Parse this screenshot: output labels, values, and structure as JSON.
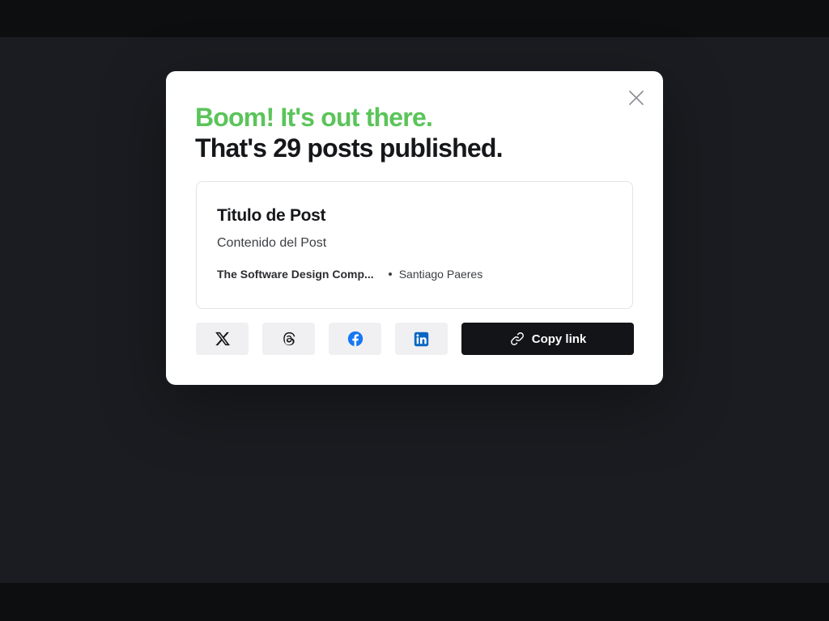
{
  "modal": {
    "headline_accent": "Boom! It's out there.",
    "headline_main": "That's 29 posts published.",
    "accent_color": "#5bc45a"
  },
  "post": {
    "title": "Titulo de Post",
    "content": "Contenido del Post",
    "company": "The Software Design Comp...",
    "author": "Santiago Paeres"
  },
  "share": {
    "buttons": [
      {
        "icon": "x-twitter-icon"
      },
      {
        "icon": "threads-icon"
      },
      {
        "icon": "facebook-icon",
        "color": "#1877f2"
      },
      {
        "icon": "linkedin-icon",
        "color": "#0a66c2"
      }
    ],
    "copy_label": "Copy link",
    "copy_icon": "link-icon"
  }
}
